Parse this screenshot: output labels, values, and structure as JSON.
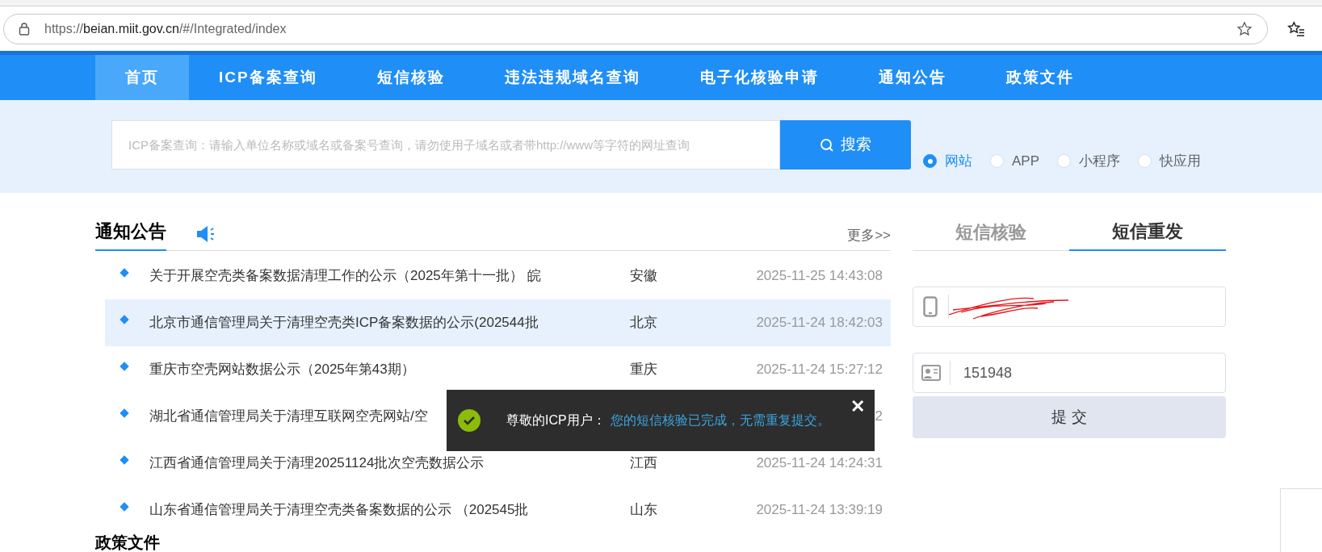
{
  "browser": {
    "url_prefix": "https://",
    "url_host": "beian.miit.gov.cn",
    "url_path": "/#/Integrated/index"
  },
  "nav": [
    {
      "label": "首页",
      "selected": true
    },
    {
      "label": "ICP备案查询",
      "selected": false
    },
    {
      "label": "短信核验",
      "selected": false
    },
    {
      "label": "违法违规域名查询",
      "selected": false
    },
    {
      "label": "电子化核验申请",
      "selected": false
    },
    {
      "label": "通知公告",
      "selected": false
    },
    {
      "label": "政策文件",
      "selected": false
    }
  ],
  "search": {
    "placeholder": "ICP备案查询：请输入单位名称或域名或备案号查询，请勿使用子域名或者带http://www等字符的网址查询",
    "button": "搜索"
  },
  "search_types": [
    {
      "label": "网站",
      "selected": true
    },
    {
      "label": "APP",
      "selected": false
    },
    {
      "label": "小程序",
      "selected": false
    },
    {
      "label": "快应用",
      "selected": false
    }
  ],
  "notices": {
    "title": "通知公告",
    "more": "更多>>",
    "rows": [
      {
        "title": "关于开展空壳类备案数据清理工作的公示（2025年第十一批） 皖",
        "region": "安徽",
        "date": "2025-11-25 14:43:08",
        "highlighted": false
      },
      {
        "title": "北京市通信管理局关于清理空壳类ICP备案数据的公示(202544批",
        "region": "北京",
        "date": "2025-11-24 18:42:03",
        "highlighted": true
      },
      {
        "title": "重庆市空壳网站数据公示（2025年第43期）",
        "region": "重庆",
        "date": "2025-11-24 15:27:12",
        "highlighted": false
      },
      {
        "title": "湖北省通信管理局关于清理互联网空壳网站/空",
        "region": "",
        "date": "2",
        "highlighted": false
      },
      {
        "title": "江西省通信管理局关于清理20251124批次空壳数据公示",
        "region": "江西",
        "date": "2025-11-24 14:24:31",
        "highlighted": false
      },
      {
        "title": "山东省通信管理局关于清理空壳类备案数据的公示 （202545批",
        "region": "山东",
        "date": "2025-11-24 13:39:19",
        "highlighted": false
      }
    ]
  },
  "next_section": {
    "title": "政策文件"
  },
  "sms_panel": {
    "tabs": [
      {
        "label": "短信核验",
        "selected": false
      },
      {
        "label": "短信重发",
        "selected": true
      }
    ],
    "code_value": "151948",
    "submit": "提 交"
  },
  "toast": {
    "prefix": "尊敬的ICP用户：",
    "message": "您的短信核验已完成，无需重复提交。",
    "close": "✕"
  }
}
